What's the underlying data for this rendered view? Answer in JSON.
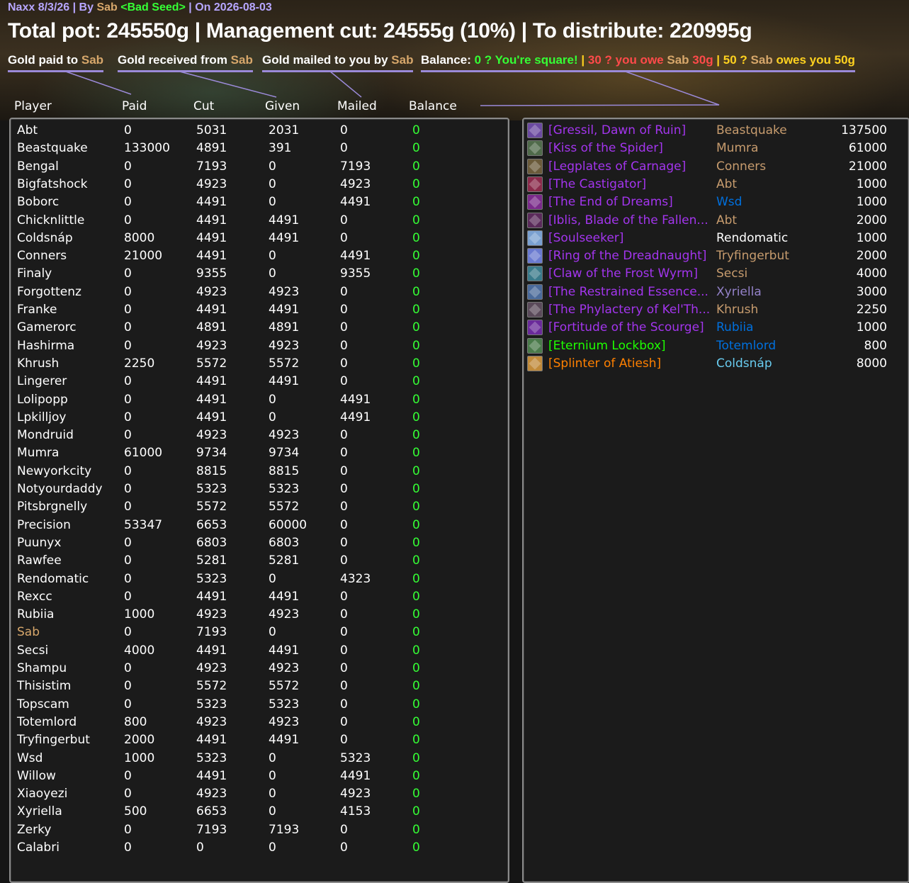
{
  "header": {
    "raid": "Naxx 8/3/26",
    "sep1": " | By ",
    "author": "Sab",
    "space": " ",
    "guild": "<Bad Seed>",
    "sep2": " | On ",
    "date": "2026-08-03",
    "totals": "Total pot: 245550g | Management cut: 24555g (10%) | To distribute: 220995g"
  },
  "legend": {
    "paid_prefix": "Gold paid to ",
    "received_prefix": "Gold received from ",
    "mailed_prefix": "Gold mailed to you by ",
    "name": "Sab",
    "balance_label": "Balance:  ",
    "square": "0 ? You're square!",
    "bar": "  |  ",
    "owe": "30 ? you owe ",
    "owe_amount": "30g",
    "owes_prefix": "50 ? ",
    "owes": " owes you 50g"
  },
  "columns": [
    "Player",
    "Paid",
    "Cut",
    "Given",
    "Mailed",
    "Balance"
  ],
  "rows": [
    {
      "name": "Abt",
      "paid": "0",
      "cut": "5031",
      "given": "2031",
      "mailed": "0",
      "balance": "0"
    },
    {
      "name": "Beastquake",
      "paid": "133000",
      "cut": "4891",
      "given": "391",
      "mailed": "0",
      "balance": "0"
    },
    {
      "name": "Bengal",
      "paid": "0",
      "cut": "7193",
      "given": "0",
      "mailed": "7193",
      "balance": "0"
    },
    {
      "name": "Bigfatshock",
      "paid": "0",
      "cut": "4923",
      "given": "0",
      "mailed": "4923",
      "balance": "0"
    },
    {
      "name": "Boborc",
      "paid": "0",
      "cut": "4491",
      "given": "0",
      "mailed": "4491",
      "balance": "0"
    },
    {
      "name": "Chicknlittle",
      "paid": "0",
      "cut": "4491",
      "given": "4491",
      "mailed": "0",
      "balance": "0"
    },
    {
      "name": "Coldsnáp",
      "paid": "8000",
      "cut": "4491",
      "given": "4491",
      "mailed": "0",
      "balance": "0"
    },
    {
      "name": "Conners",
      "paid": "21000",
      "cut": "4491",
      "given": "0",
      "mailed": "4491",
      "balance": "0"
    },
    {
      "name": "Finaly",
      "paid": "0",
      "cut": "9355",
      "given": "0",
      "mailed": "9355",
      "balance": "0"
    },
    {
      "name": "Forgottenz",
      "paid": "0",
      "cut": "4923",
      "given": "4923",
      "mailed": "0",
      "balance": "0"
    },
    {
      "name": "Franke",
      "paid": "0",
      "cut": "4491",
      "given": "4491",
      "mailed": "0",
      "balance": "0"
    },
    {
      "name": "Gamerorc",
      "paid": "0",
      "cut": "4891",
      "given": "4891",
      "mailed": "0",
      "balance": "0"
    },
    {
      "name": "Hashirma",
      "paid": "0",
      "cut": "4923",
      "given": "4923",
      "mailed": "0",
      "balance": "0"
    },
    {
      "name": "Khrush",
      "paid": "2250",
      "cut": "5572",
      "given": "5572",
      "mailed": "0",
      "balance": "0"
    },
    {
      "name": "Lingerer",
      "paid": "0",
      "cut": "4491",
      "given": "4491",
      "mailed": "0",
      "balance": "0"
    },
    {
      "name": "Lolipopp",
      "paid": "0",
      "cut": "4491",
      "given": "0",
      "mailed": "4491",
      "balance": "0"
    },
    {
      "name": "Lpkilljoy",
      "paid": "0",
      "cut": "4491",
      "given": "0",
      "mailed": "4491",
      "balance": "0"
    },
    {
      "name": "Mondruid",
      "paid": "0",
      "cut": "4923",
      "given": "4923",
      "mailed": "0",
      "balance": "0"
    },
    {
      "name": "Mumra",
      "paid": "61000",
      "cut": "9734",
      "given": "9734",
      "mailed": "0",
      "balance": "0"
    },
    {
      "name": "Newyorkcity",
      "paid": "0",
      "cut": "8815",
      "given": "8815",
      "mailed": "0",
      "balance": "0"
    },
    {
      "name": "Notyourdaddy",
      "paid": "0",
      "cut": "5323",
      "given": "5323",
      "mailed": "0",
      "balance": "0"
    },
    {
      "name": "Pitsbrgnelly",
      "paid": "0",
      "cut": "5572",
      "given": "5572",
      "mailed": "0",
      "balance": "0"
    },
    {
      "name": "Precision",
      "paid": "53347",
      "cut": "6653",
      "given": "60000",
      "mailed": "0",
      "balance": "0"
    },
    {
      "name": "Puunyx",
      "paid": "0",
      "cut": "6803",
      "given": "6803",
      "mailed": "0",
      "balance": "0"
    },
    {
      "name": "Rawfee",
      "paid": "0",
      "cut": "5281",
      "given": "5281",
      "mailed": "0",
      "balance": "0"
    },
    {
      "name": "Rendomatic",
      "paid": "0",
      "cut": "5323",
      "given": "0",
      "mailed": "4323",
      "balance": "0"
    },
    {
      "name": "Rexcc",
      "paid": "0",
      "cut": "4491",
      "given": "4491",
      "mailed": "0",
      "balance": "0"
    },
    {
      "name": "Rubiia",
      "paid": "1000",
      "cut": "4923",
      "given": "4923",
      "mailed": "0",
      "balance": "0"
    },
    {
      "name": "Sab",
      "paid": "0",
      "cut": "7193",
      "given": "0",
      "mailed": "0",
      "balance": "0",
      "self": true
    },
    {
      "name": "Secsi",
      "paid": "4000",
      "cut": "4491",
      "given": "4491",
      "mailed": "0",
      "balance": "0"
    },
    {
      "name": "Shampu",
      "paid": "0",
      "cut": "4923",
      "given": "4923",
      "mailed": "0",
      "balance": "0"
    },
    {
      "name": "Thisistim",
      "paid": "0",
      "cut": "5572",
      "given": "5572",
      "mailed": "0",
      "balance": "0"
    },
    {
      "name": "Topscam",
      "paid": "0",
      "cut": "5323",
      "given": "5323",
      "mailed": "0",
      "balance": "0"
    },
    {
      "name": "Totemlord",
      "paid": "800",
      "cut": "4923",
      "given": "4923",
      "mailed": "0",
      "balance": "0"
    },
    {
      "name": "Tryfingerbut",
      "paid": "2000",
      "cut": "4491",
      "given": "4491",
      "mailed": "0",
      "balance": "0"
    },
    {
      "name": "Wsd",
      "paid": "1000",
      "cut": "5323",
      "given": "0",
      "mailed": "5323",
      "balance": "0"
    },
    {
      "name": "Willow",
      "paid": "0",
      "cut": "4491",
      "given": "0",
      "mailed": "4491",
      "balance": "0"
    },
    {
      "name": "Xiaoyezi",
      "paid": "0",
      "cut": "4923",
      "given": "0",
      "mailed": "4923",
      "balance": "0"
    },
    {
      "name": "Xyriella",
      "paid": "500",
      "cut": "6653",
      "given": "0",
      "mailed": "4153",
      "balance": "0"
    },
    {
      "name": "Zerky",
      "paid": "0",
      "cut": "7193",
      "given": "7193",
      "mailed": "0",
      "balance": "0"
    },
    {
      "name": "Calabri",
      "paid": "0",
      "cut": "0",
      "given": "0",
      "mailed": "0",
      "balance": "0"
    }
  ],
  "loot": [
    {
      "item": "[Gressil, Dawn of Ruin]",
      "quality": "epic",
      "winner": "Beastquake",
      "winner_color": "#c79c6e",
      "price": "137500",
      "icon": "sword-icon",
      "icon_color": "#6b4aa0"
    },
    {
      "item": "[Kiss of the Spider]",
      "quality": "epic",
      "winner": "Mumra",
      "winner_color": "#c79c6e",
      "price": "61000",
      "icon": "trinket-icon",
      "icon_color": "#4f6a4a"
    },
    {
      "item": "[Legplates of Carnage]",
      "quality": "epic",
      "winner": "Conners",
      "winner_color": "#c79c6e",
      "price": "21000",
      "icon": "legplates-icon",
      "icon_color": "#6a5a3a"
    },
    {
      "item": "[The Castigator]",
      "quality": "epic",
      "winner": "Abt",
      "winner_color": "#c79c6e",
      "price": "1000",
      "icon": "axe-icon",
      "icon_color": "#8a2a4a"
    },
    {
      "item": "[The End of Dreams]",
      "quality": "epic",
      "winner": "Wsd",
      "winner_color": "#0070de",
      "price": "1000",
      "icon": "mace-icon",
      "icon_color": "#7a2a8a"
    },
    {
      "item": "[Iblis, Blade of the Fallen...",
      "quality": "epic",
      "winner": "Abt",
      "winner_color": "#c79c6e",
      "price": "2000",
      "icon": "blade-icon",
      "icon_color": "#5a2a5a"
    },
    {
      "item": "[Soulseeker]",
      "quality": "epic",
      "winner": "Rendomatic",
      "winner_color": "#ffffff",
      "price": "1000",
      "icon": "staff-icon",
      "icon_color": "#7aa0d0"
    },
    {
      "item": "[Ring of the Dreadnaught]",
      "quality": "epic",
      "winner": "Tryfingerbut",
      "winner_color": "#c79c6e",
      "price": "2000",
      "icon": "ring-icon",
      "icon_color": "#6a7ad0"
    },
    {
      "item": "[Claw of the Frost Wyrm]",
      "quality": "epic",
      "winner": "Secsi",
      "winner_color": "#c79c6e",
      "price": "4000",
      "icon": "claw-icon",
      "icon_color": "#3a7a8a"
    },
    {
      "item": "[The Restrained Essence...",
      "quality": "epic",
      "winner": "Xyriella",
      "winner_color": "#9482c9",
      "price": "3000",
      "icon": "orb-icon",
      "icon_color": "#4a6a9a"
    },
    {
      "item": "[The Phylactery of Kel'Th...",
      "quality": "epic",
      "winner": "Khrush",
      "winner_color": "#c79c6e",
      "price": "2250",
      "icon": "phylactery-icon",
      "icon_color": "#5a4a5a"
    },
    {
      "item": "[Fortitude of the Scourge]",
      "quality": "epic",
      "winner": "Rubiia",
      "winner_color": "#0070de",
      "price": "1000",
      "icon": "rune-icon",
      "icon_color": "#6a2a9a"
    },
    {
      "item": "[Eternium Lockbox]",
      "quality": "uncommon",
      "winner": "Totemlord",
      "winner_color": "#0070de",
      "price": "800",
      "icon": "lockbox-icon",
      "icon_color": "#4a7a4a"
    },
    {
      "item": "[Splinter of Atiesh]",
      "quality": "legendary",
      "winner": "Coldsnáp",
      "winner_color": "#69ccf0",
      "price": "8000",
      "icon": "splinter-icon",
      "icon_color": "#c08a3a"
    }
  ],
  "colors": {
    "title_lavender": "#b7a6ff",
    "self_gold": "#d7a76b",
    "guild_green": "#35ff35",
    "balance_zero": "#35ff35",
    "owe_red": "#ff4a4a",
    "owes_yellow": "#ffd21f",
    "epic": "#a335ee",
    "uncommon": "#1eff00",
    "legendary": "#ff8000"
  }
}
